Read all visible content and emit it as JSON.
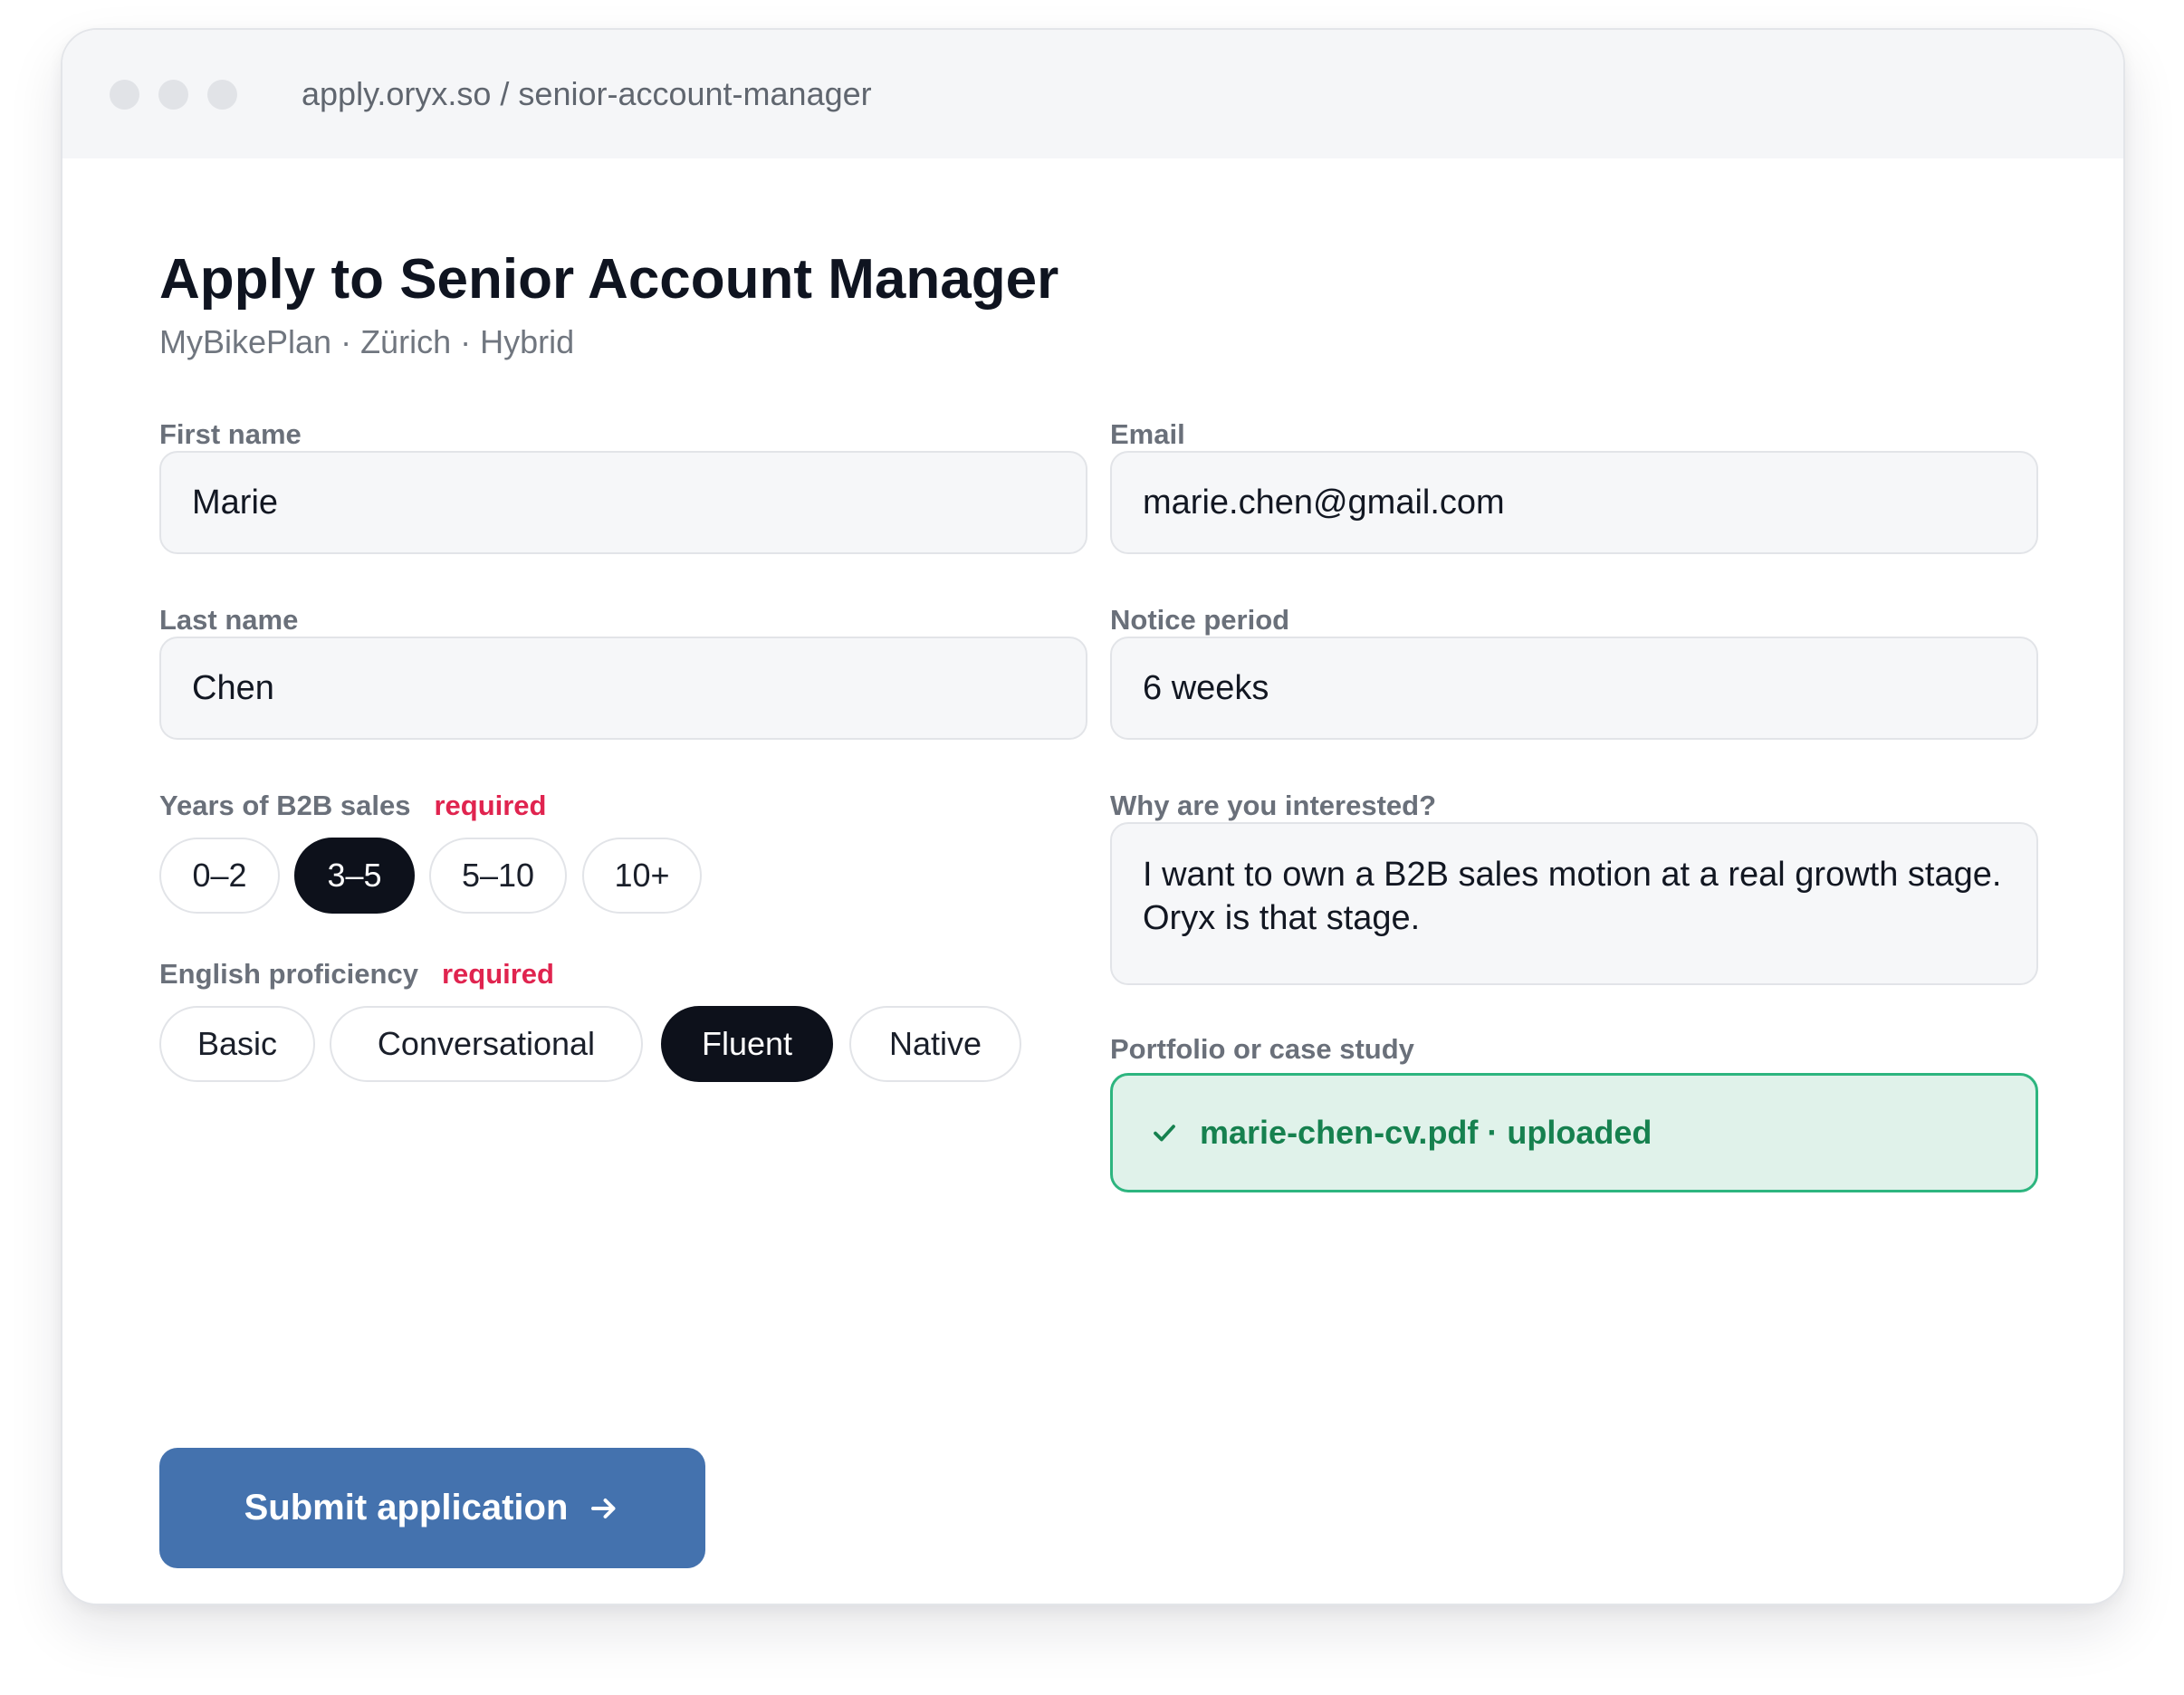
{
  "browser": {
    "url": "apply.oryx.so / senior-account-manager"
  },
  "header": {
    "title": "Apply to Senior Account Manager",
    "subtitle": "MyBikePlan · Zürich · Hybrid"
  },
  "form": {
    "first_name": {
      "label": "First name",
      "value": "Marie"
    },
    "last_name": {
      "label": "Last name",
      "value": "Chen"
    },
    "email": {
      "label": "Email",
      "value": "marie.chen@gmail.com"
    },
    "notice_period": {
      "label": "Notice period",
      "value": "6 weeks"
    },
    "years_b2b": {
      "label": "Years of B2B sales",
      "required_label": "required",
      "options": [
        "0–2",
        "3–5",
        "5–10",
        "10+"
      ],
      "selected": "3–5"
    },
    "english": {
      "label": "English proficiency",
      "required_label": "required",
      "options": [
        "Basic",
        "Conversational",
        "Fluent",
        "Native"
      ],
      "selected": "Fluent"
    },
    "why_interested": {
      "label": "Why are you interested?",
      "value": "I want to own a B2B sales motion at a real growth stage. Oryx is that stage."
    },
    "portfolio": {
      "label": "Portfolio or case study",
      "status_text": "marie-chen-cv.pdf · uploaded",
      "status_icon": "check-icon"
    },
    "submit_label": "Submit application",
    "submit_icon": "arrow-right-icon"
  },
  "colors": {
    "accent": "#4472ae",
    "selected_pill": "#0d111b",
    "required": "#e0244f",
    "success_text": "#16814f",
    "success_border": "#2db57f",
    "success_bg": "#e0f2ea"
  }
}
